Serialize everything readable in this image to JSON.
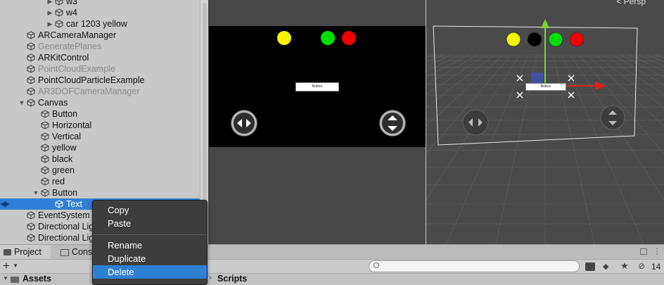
{
  "hierarchy": {
    "items": [
      {
        "label": "w3",
        "depth": 4,
        "arrow": "collapsed",
        "state": "normal"
      },
      {
        "label": "w4",
        "depth": 4,
        "arrow": "collapsed",
        "state": "normal"
      },
      {
        "label": "car 1203 yellow",
        "depth": 4,
        "arrow": "collapsed",
        "state": "normal"
      },
      {
        "label": "ARCameraManager",
        "depth": 2,
        "arrow": "none",
        "state": "normal"
      },
      {
        "label": "GeneratePlanes",
        "depth": 2,
        "arrow": "none",
        "state": "inactive"
      },
      {
        "label": "ARKitControl",
        "depth": 2,
        "arrow": "none",
        "state": "normal"
      },
      {
        "label": "PointCloudExample",
        "depth": 2,
        "arrow": "none",
        "state": "inactive"
      },
      {
        "label": "PointCloudParticleExample",
        "depth": 2,
        "arrow": "none",
        "state": "normal"
      },
      {
        "label": "AR3DOFCameraManager",
        "depth": 2,
        "arrow": "none",
        "state": "inactive"
      },
      {
        "label": "Canvas",
        "depth": 2,
        "arrow": "expanded",
        "state": "normal"
      },
      {
        "label": "Button",
        "depth": 3,
        "arrow": "none",
        "state": "normal"
      },
      {
        "label": "Horizontal",
        "depth": 3,
        "arrow": "none",
        "state": "normal"
      },
      {
        "label": "Vertical",
        "depth": 3,
        "arrow": "none",
        "state": "normal"
      },
      {
        "label": "yellow",
        "depth": 3,
        "arrow": "none",
        "state": "normal"
      },
      {
        "label": "black",
        "depth": 3,
        "arrow": "none",
        "state": "normal"
      },
      {
        "label": "green",
        "depth": 3,
        "arrow": "none",
        "state": "normal"
      },
      {
        "label": "red",
        "depth": 3,
        "arrow": "none",
        "state": "normal"
      },
      {
        "label": "Button",
        "depth": 3,
        "arrow": "expanded",
        "state": "normal"
      },
      {
        "label": "Text",
        "depth": 4,
        "arrow": "none",
        "state": "selected"
      },
      {
        "label": "EventSystem",
        "depth": 2,
        "arrow": "none",
        "state": "normal"
      },
      {
        "label": "Directional Light",
        "depth": 2,
        "arrow": "none",
        "state": "normal"
      },
      {
        "label": "Directional Light",
        "depth": 2,
        "arrow": "none",
        "state": "normal"
      }
    ]
  },
  "game_view": {
    "button_text": "Button",
    "lights": [
      {
        "name": "yellow",
        "color": "#f5f500"
      },
      {
        "name": "green",
        "color": "#00e000"
      },
      {
        "name": "red",
        "color": "#f00000"
      }
    ]
  },
  "scene_view": {
    "persp_label": "< Persp",
    "button_text": "Button",
    "lights": [
      {
        "name": "yellow",
        "color": "#f5f500"
      },
      {
        "name": "black",
        "color": "#000000"
      },
      {
        "name": "green",
        "color": "#00e000"
      },
      {
        "name": "red",
        "color": "#f00000"
      }
    ]
  },
  "context_menu": {
    "items": [
      "Copy",
      "Paste",
      "Rename",
      "Duplicate",
      "Delete"
    ],
    "highlighted": "Delete"
  },
  "bottom_panel": {
    "tabs": [
      "Project",
      "Cons"
    ],
    "add_label": "+",
    "hidden_count": "14",
    "assets_label": "Assets",
    "scripts_label": "Scripts"
  },
  "colors": {
    "accent": "#2f7fd6",
    "panel": "#c8c8c8",
    "menu_bg": "#3d3d3d"
  }
}
